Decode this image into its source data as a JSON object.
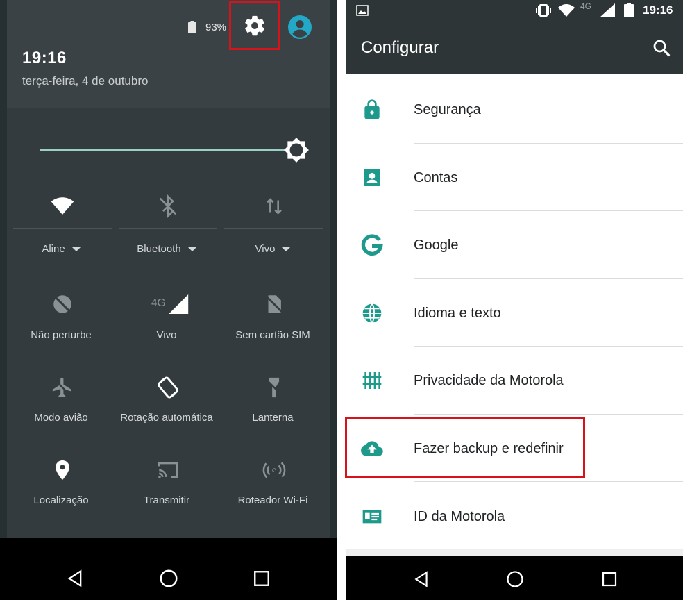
{
  "left_panel": {
    "status": {
      "battery": "93%"
    },
    "header": {
      "time": "19:16",
      "date": "terça-feira, 4 de outubro"
    },
    "tiles_row1": [
      {
        "icon": "wifi-icon",
        "label": "Aline"
      },
      {
        "icon": "bluetooth-off-icon",
        "label": "Bluetooth"
      },
      {
        "icon": "data-arrows-icon",
        "label": "Vivo"
      }
    ],
    "tiles": [
      {
        "icon": "do-not-disturb-icon",
        "label": "Não perturbe"
      },
      {
        "icon": "signal-4g-icon",
        "label": "Vivo",
        "badge": "4G"
      },
      {
        "icon": "no-sim-icon",
        "label": "Sem cartão SIM"
      },
      {
        "icon": "airplane-icon",
        "label": "Modo avião"
      },
      {
        "icon": "auto-rotate-icon",
        "label": "Rotação automática"
      },
      {
        "icon": "flashlight-icon",
        "label": "Lanterna"
      },
      {
        "icon": "location-icon",
        "label": "Localização"
      },
      {
        "icon": "cast-icon",
        "label": "Transmitir"
      },
      {
        "icon": "hotspot-icon",
        "label": "Roteador Wi-Fi"
      }
    ],
    "brightness_level": 0.95
  },
  "right_panel": {
    "status": {
      "time": "19:16",
      "network": "4G"
    },
    "toolbar": {
      "title": "Configurar"
    },
    "items": [
      {
        "icon": "lock-icon",
        "label": "Segurança"
      },
      {
        "icon": "account-icon",
        "label": "Contas"
      },
      {
        "icon": "google-icon",
        "label": "Google"
      },
      {
        "icon": "globe-icon",
        "label": "Idioma e texto"
      },
      {
        "icon": "privacy-icon",
        "label": "Privacidade da Motorola"
      },
      {
        "icon": "cloud-upload-icon",
        "label": "Fazer backup e redefinir"
      },
      {
        "icon": "id-card-icon",
        "label": "ID da Motorola"
      }
    ]
  },
  "colors": {
    "accent": "#1e9a8c",
    "highlight": "#d6131b",
    "shade": "#343b3e",
    "toolbar": "#2e3537"
  }
}
